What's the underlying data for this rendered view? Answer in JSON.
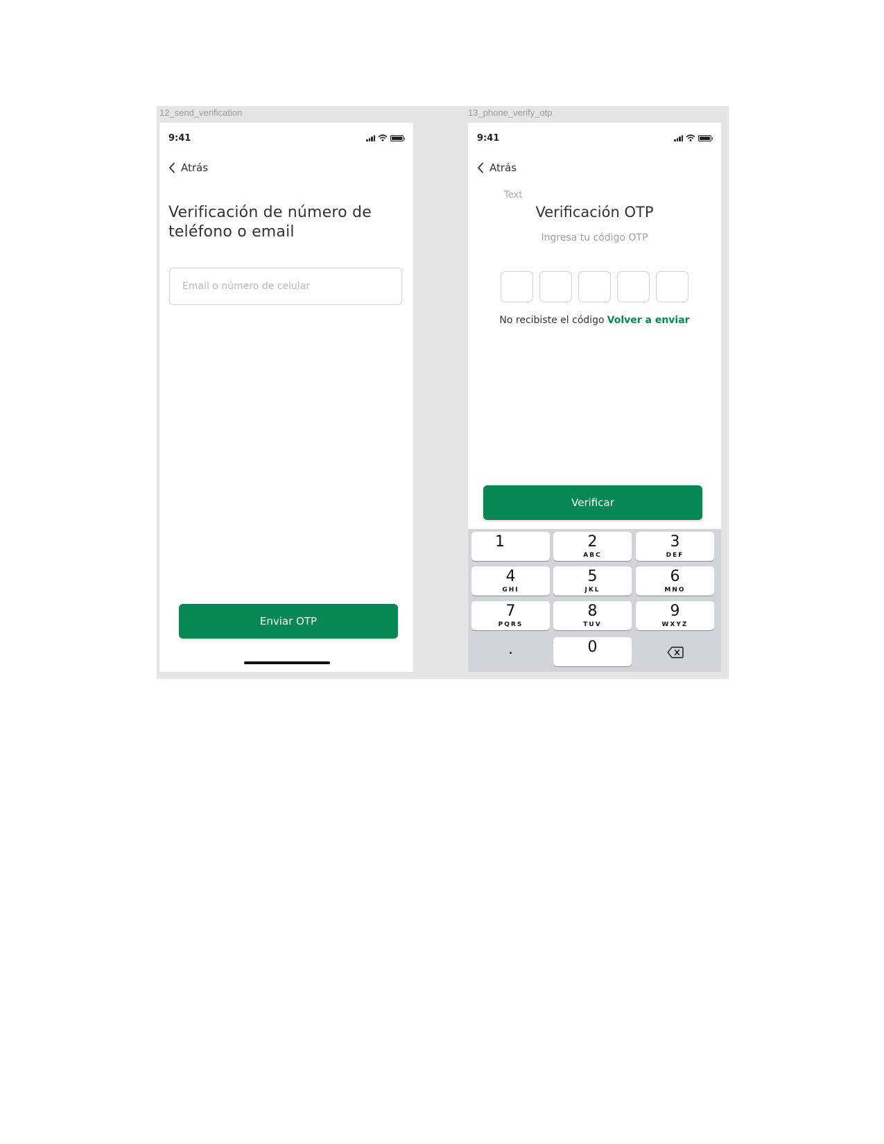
{
  "frames": [
    {
      "label": "12_send_verification",
      "status_time": "9:41",
      "back_label": "Atrás",
      "title": "Verificación de número de teléfono o email",
      "input_placeholder": "Email o número de celular",
      "input_value": "",
      "button_label": "Enviar OTP"
    },
    {
      "label": "13_phone_verify_otp",
      "status_time": "9:41",
      "back_label": "Atrás",
      "small_text": "Text",
      "title": "Verificación OTP",
      "subtitle": "Ingresa tu código OTP",
      "otp_digits": [
        "",
        "",
        "",
        "",
        ""
      ],
      "resend_prompt": "No recibiste el código",
      "resend_link": "Volver a enviar",
      "button_label": "Verificar",
      "keypad": [
        {
          "num": "1",
          "letters": ""
        },
        {
          "num": "2",
          "letters": "ABC"
        },
        {
          "num": "3",
          "letters": "DEF"
        },
        {
          "num": "4",
          "letters": "GHI"
        },
        {
          "num": "5",
          "letters": "JKL"
        },
        {
          "num": "6",
          "letters": "MNO"
        },
        {
          "num": "7",
          "letters": "PQRS"
        },
        {
          "num": "8",
          "letters": "TUV"
        },
        {
          "num": "9",
          "letters": "WXYZ"
        },
        {
          "num": "0",
          "letters": ""
        }
      ],
      "decimal_key": "."
    }
  ],
  "colors": {
    "primary": "#078852",
    "board_bg": "#e5e5e5",
    "keypad_bg": "#d1d4d9"
  },
  "icons": [
    "signal-icon",
    "wifi-icon",
    "battery-icon",
    "chevron-left-icon",
    "backspace-icon"
  ]
}
